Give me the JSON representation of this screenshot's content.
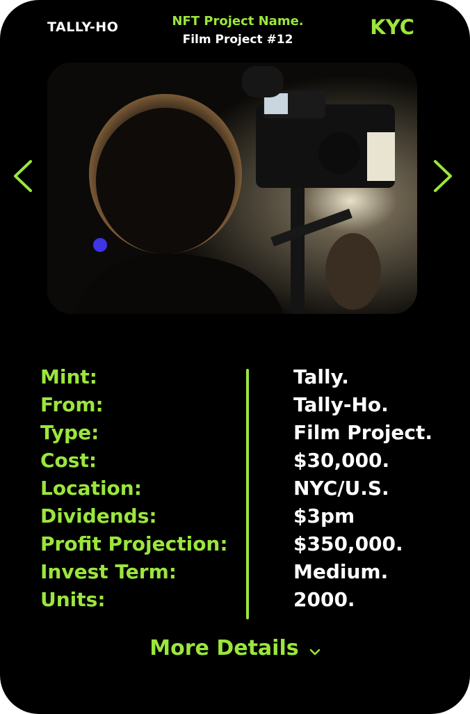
{
  "header": {
    "logo_text": "TALLY-HO",
    "project_name": "NFT Project Name.",
    "project_sub": "Film Project #12",
    "badge": "KYC"
  },
  "carousel": {
    "prev_icon": "chevron-left-icon",
    "next_icon": "chevron-right-icon",
    "image_subject": "camera-operator-photo"
  },
  "stats": [
    {
      "label": "Mint:",
      "value": "Tally."
    },
    {
      "label": "From:",
      "value": "Tally-Ho."
    },
    {
      "label": "Type:",
      "value": "Film Project."
    },
    {
      "label": "Cost:",
      "value": "$30,000."
    },
    {
      "label": "Location:",
      "value": "NYC/U.S."
    },
    {
      "label": "Dividends:",
      "value": "$3pm"
    },
    {
      "label": "Profit Projection:",
      "value": "$350,000."
    },
    {
      "label": "Invest Term:",
      "value": "Medium."
    },
    {
      "label": "Units:",
      "value": "2000."
    }
  ],
  "footer": {
    "more_label": "More Details",
    "more_icon": "chevron-down-icon"
  },
  "colors": {
    "accent": "#9be63c",
    "background": "#000000",
    "text": "#ffffff"
  }
}
